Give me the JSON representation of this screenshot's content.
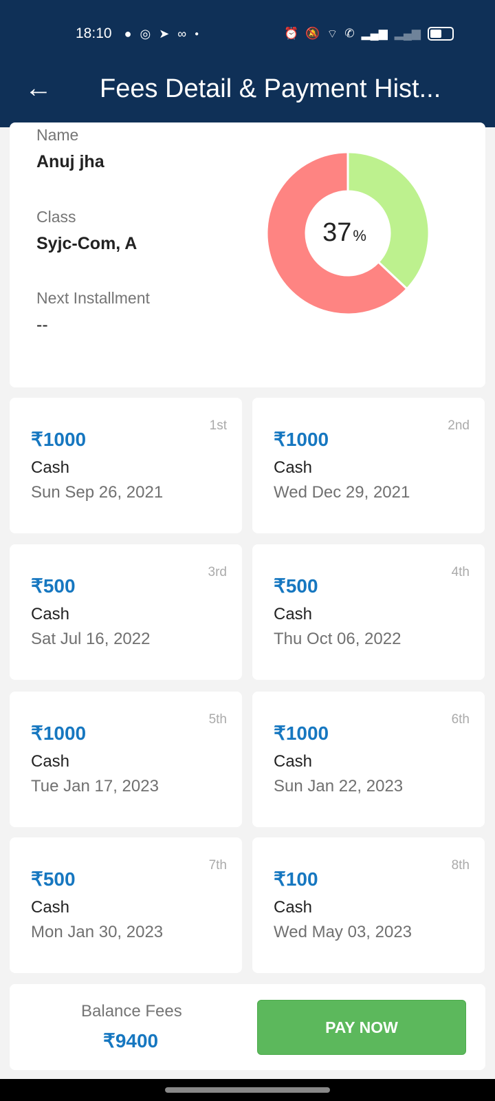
{
  "status_bar": {
    "time": "18:10"
  },
  "header": {
    "title": "Fees Detail & Payment Hist..."
  },
  "student": {
    "name_label": "Name",
    "name": "Anuj jha",
    "class_label": "Class",
    "class": "Syjc-Com, A",
    "next_label": "Next Installment",
    "next": "--"
  },
  "progress": {
    "percent": 37,
    "value_text": "37",
    "unit": "%",
    "paid_color": "#bdf18e",
    "due_color": "#fe8482"
  },
  "payments": [
    {
      "amount": "₹1000",
      "mode": "Cash",
      "date": "Sun Sep 26, 2021",
      "order": "1st"
    },
    {
      "amount": "₹1000",
      "mode": "Cash",
      "date": "Wed Dec 29, 2021",
      "order": "2nd"
    },
    {
      "amount": "₹500",
      "mode": "Cash",
      "date": "Sat Jul 16, 2022",
      "order": "3rd"
    },
    {
      "amount": "₹500",
      "mode": "Cash",
      "date": "Thu Oct 06, 2022",
      "order": "4th"
    },
    {
      "amount": "₹1000",
      "mode": "Cash",
      "date": "Tue Jan 17, 2023",
      "order": "5th"
    },
    {
      "amount": "₹1000",
      "mode": "Cash",
      "date": "Sun Jan 22, 2023",
      "order": "6th"
    },
    {
      "amount": "₹500",
      "mode": "Cash",
      "date": "Mon Jan 30, 2023",
      "order": "7th"
    },
    {
      "amount": "₹100",
      "mode": "Cash",
      "date": "Wed May 03, 2023",
      "order": "8th"
    }
  ],
  "balance": {
    "label": "Balance Fees",
    "value": "₹9400",
    "pay_label": "PAY NOW"
  }
}
